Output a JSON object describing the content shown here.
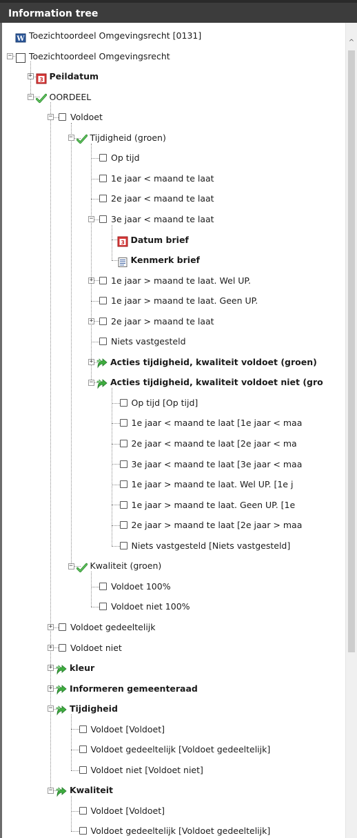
{
  "panel": {
    "title": "Information tree"
  },
  "scrollbar": {
    "up_arrow": "^"
  },
  "tree": [
    {
      "label": "Toezichtoordeel Omgevingsrecht [0131]",
      "icon": "word-doc-icon",
      "depth": 0,
      "expander": "none"
    },
    {
      "label": "Toezichtoordeel Omgevingsrecht",
      "icon": "page-icon",
      "depth": 0,
      "expander": "minus"
    },
    {
      "label": "Peildatum",
      "icon": "calendar-icon",
      "depth": 1,
      "expander": "plus",
      "bold": true
    },
    {
      "label": "OORDEEL",
      "icon": "green-check-icon",
      "depth": 1,
      "expander": "minus"
    },
    {
      "label": "Voldoet",
      "icon": "checkbox-icon",
      "depth": 2,
      "expander": "minus"
    },
    {
      "label": "Tijdigheid (groen)",
      "icon": "green-check-icon",
      "depth": 3,
      "expander": "minus"
    },
    {
      "label": "Op tijd",
      "icon": "checkbox-icon",
      "depth": 4,
      "expander": "none"
    },
    {
      "label": "1e jaar < maand te laat",
      "icon": "checkbox-icon",
      "depth": 4,
      "expander": "none"
    },
    {
      "label": "2e jaar < maand  te laat",
      "icon": "checkbox-icon",
      "depth": 4,
      "expander": "none"
    },
    {
      "label": "3e jaar < maand te laat",
      "icon": "checkbox-icon",
      "depth": 4,
      "expander": "minus"
    },
    {
      "label": "Datum brief",
      "icon": "calendar-icon",
      "depth": 5,
      "expander": "none",
      "bold": true
    },
    {
      "label": "Kenmerk brief",
      "icon": "text-doc-icon",
      "depth": 5,
      "expander": "none",
      "bold": true
    },
    {
      "label": "1e jaar > maand te laat. Wel UP.",
      "icon": "checkbox-icon",
      "depth": 4,
      "expander": "plus"
    },
    {
      "label": "1e jaar > maand te laat. Geen UP.",
      "icon": "checkbox-icon",
      "depth": 4,
      "expander": "none"
    },
    {
      "label": "2e jaar > maand te laat",
      "icon": "checkbox-icon",
      "depth": 4,
      "expander": "plus"
    },
    {
      "label": "Niets vastgesteld",
      "icon": "checkbox-icon",
      "depth": 4,
      "expander": "none"
    },
    {
      "label": "Acties tijdigheid, kwaliteit voldoet (groen)",
      "icon": "green-arrow-icon",
      "depth": 4,
      "expander": "plus",
      "bold": true
    },
    {
      "label": "Acties tijdigheid, kwaliteit voldoet niet (gro",
      "icon": "green-arrow-icon",
      "depth": 4,
      "expander": "minus",
      "bold": true
    },
    {
      "label": "Op tijd [Op tijd]",
      "icon": "checkbox-icon",
      "depth": 5,
      "expander": "none"
    },
    {
      "label": "1e jaar < maand te laat [1e jaar < maa",
      "icon": "checkbox-icon",
      "depth": 5,
      "expander": "none"
    },
    {
      "label": "2e jaar < maand  te laat [2e jaar < ma",
      "icon": "checkbox-icon",
      "depth": 5,
      "expander": "none"
    },
    {
      "label": "3e jaar < maand te laat [3e jaar < maa",
      "icon": "checkbox-icon",
      "depth": 5,
      "expander": "none"
    },
    {
      "label": "1e jaar > maand te laat. Wel UP. [1e j",
      "icon": "checkbox-icon",
      "depth": 5,
      "expander": "none"
    },
    {
      "label": "1e jaar > maand te laat. Geen UP. [1e",
      "icon": "checkbox-icon",
      "depth": 5,
      "expander": "none"
    },
    {
      "label": "2e jaar > maand te laat [2e jaar > maa",
      "icon": "checkbox-icon",
      "depth": 5,
      "expander": "none"
    },
    {
      "label": "Niets vastgesteld [Niets vastgesteld]",
      "icon": "checkbox-icon",
      "depth": 5,
      "expander": "none"
    },
    {
      "label": "Kwaliteit (groen)",
      "icon": "green-check-icon",
      "depth": 3,
      "expander": "minus"
    },
    {
      "label": "Voldoet 100%",
      "icon": "checkbox-icon",
      "depth": 4,
      "expander": "none"
    },
    {
      "label": "Voldoet niet 100%",
      "icon": "checkbox-icon",
      "depth": 4,
      "expander": "none"
    },
    {
      "label": "Voldoet gedeeltelijk",
      "icon": "checkbox-icon",
      "depth": 2,
      "expander": "plus"
    },
    {
      "label": "Voldoet niet",
      "icon": "checkbox-icon",
      "depth": 2,
      "expander": "plus"
    },
    {
      "label": "kleur",
      "icon": "green-arrow-icon",
      "depth": 2,
      "expander": "plus",
      "bold": true
    },
    {
      "label": "Informeren gemeenteraad",
      "icon": "green-arrow-icon",
      "depth": 2,
      "expander": "plus",
      "bold": true
    },
    {
      "label": "Tijdigheid",
      "icon": "green-arrow-icon",
      "depth": 2,
      "expander": "minus",
      "bold": true
    },
    {
      "label": "Voldoet [Voldoet]",
      "icon": "checkbox-icon",
      "depth": 3,
      "expander": "none"
    },
    {
      "label": "Voldoet gedeeltelijk [Voldoet gedeeltelijk]",
      "icon": "checkbox-icon",
      "depth": 3,
      "expander": "none"
    },
    {
      "label": "Voldoet niet [Voldoet niet]",
      "icon": "checkbox-icon",
      "depth": 3,
      "expander": "none"
    },
    {
      "label": "Kwaliteit",
      "icon": "green-arrow-icon",
      "depth": 2,
      "expander": "minus",
      "bold": true
    },
    {
      "label": "Voldoet [Voldoet]",
      "icon": "checkbox-icon",
      "depth": 3,
      "expander": "none"
    },
    {
      "label": "Voldoet gedeeltelijk [Voldoet gedeeltelijk]",
      "icon": "checkbox-icon",
      "depth": 3,
      "expander": "none"
    }
  ]
}
